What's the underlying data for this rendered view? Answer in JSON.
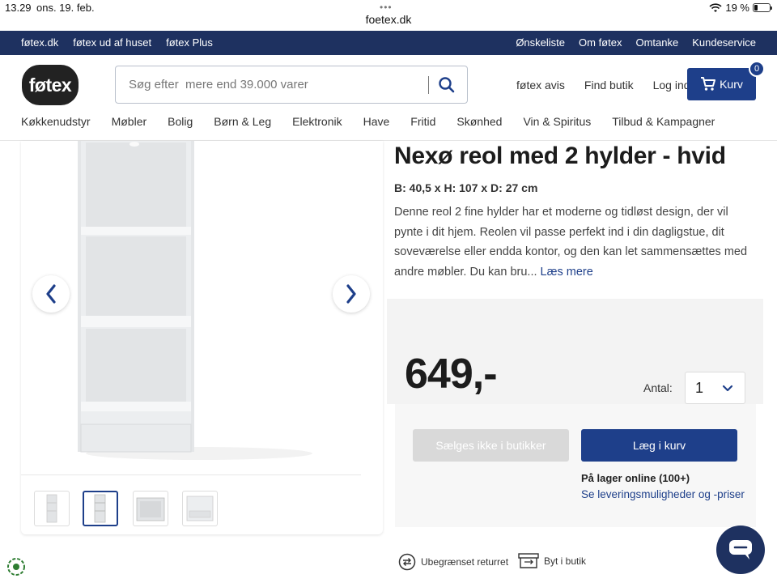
{
  "status": {
    "time": "13.29",
    "date": "ons. 19. feb.",
    "url": "foetex.dk",
    "battery": "19 %"
  },
  "topnav": {
    "left": [
      "føtex.dk",
      "føtex ud af huset",
      "føtex Plus"
    ],
    "right": [
      "Ønskeliste",
      "Om føtex",
      "Omtanke",
      "Kundeservice"
    ]
  },
  "header": {
    "logo": "føtex",
    "search_placeholder": "Søg efter  mere end 39.000 varer",
    "links": [
      "føtex avis",
      "Find butik",
      "Log ind"
    ],
    "cart_label": "Kurv",
    "cart_count": "0"
  },
  "categories": [
    "Køkkenudstyr",
    "Møbler",
    "Bolig",
    "Børn & Leg",
    "Elektronik",
    "Have",
    "Fritid",
    "Skønhed",
    "Vin & Spiritus",
    "Tilbud & Kampagner"
  ],
  "product": {
    "title": "Nexø reol med 2 hylder - hvid",
    "dimensions": "B: 40,5 x H: 107 x D: 27 cm",
    "description": "Denne reol 2 fine hylder har et moderne og tidløst design, der vil pynte i dit hjem. Reolen vil passe perfekt ind i din dagligstue, dit soveværelse eller endda kontor, og den kan let sammensættes med andre møbler. Du kan bru...",
    "read_more": "Læs mere",
    "price": "649,-",
    "qty_label": "Antal:",
    "qty_value": "1",
    "btn_store": "Sælges ikke i butikker",
    "btn_cart": "Læg i kurv",
    "stock": "På lager online (100+)",
    "delivery": "Se leveringsmuligheder og -priser"
  },
  "features": [
    "Ubegrænset returret",
    "Byt i butik"
  ],
  "colors": {
    "navy": "#1e3160",
    "brand_blue": "#1e3f8a"
  }
}
